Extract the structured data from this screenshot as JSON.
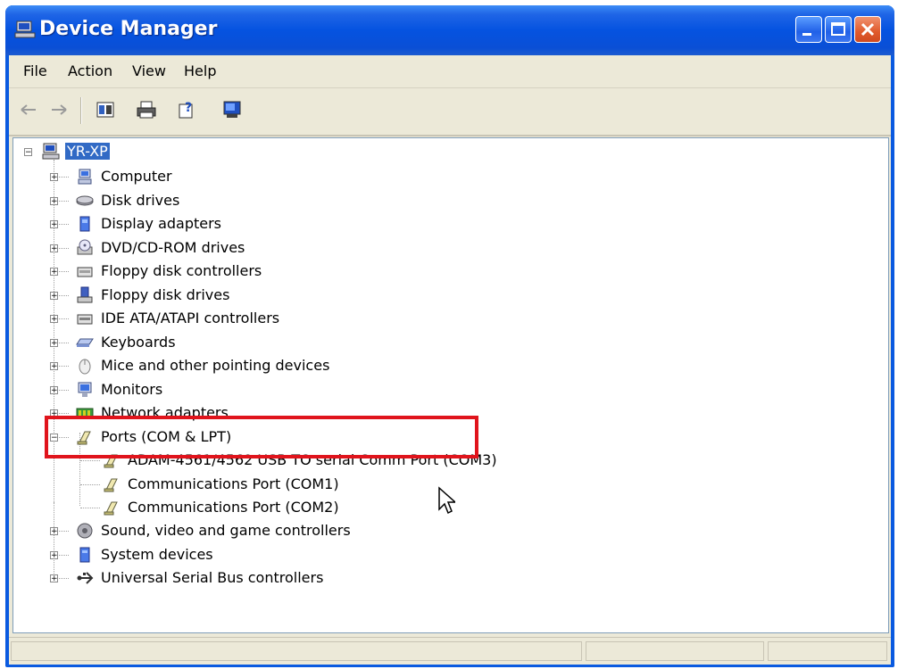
{
  "window": {
    "title": "Device Manager"
  },
  "menu": [
    "File",
    "Action",
    "View",
    "Help"
  ],
  "toolbar": {
    "back_icon": "back-arrow-icon",
    "forward_icon": "forward-arrow-icon",
    "buttons": [
      "properties-icon",
      "print-icon",
      "help-icon",
      "scan-hardware-icon"
    ]
  },
  "tree": {
    "root": "YR-XP",
    "categories": [
      "Computer",
      "Disk drives",
      "Display adapters",
      "DVD/CD-ROM drives",
      "Floppy disk controllers",
      "Floppy disk drives",
      "IDE ATA/ATAPI controllers",
      "Keyboards",
      "Mice and other pointing devices",
      "Monitors",
      "Network adapters",
      "Ports (COM & LPT)"
    ],
    "ports": [
      "ADAM-4561/4562 USB TO serial Comm Port (COM3)",
      "Communications Port (COM1)",
      "Communications Port (COM2)"
    ],
    "after": [
      "Sound, video and game controllers",
      "System devices",
      "Universal Serial Bus controllers"
    ]
  },
  "colors": {
    "highlight": "#e0141c",
    "selection": "#316ac5"
  }
}
